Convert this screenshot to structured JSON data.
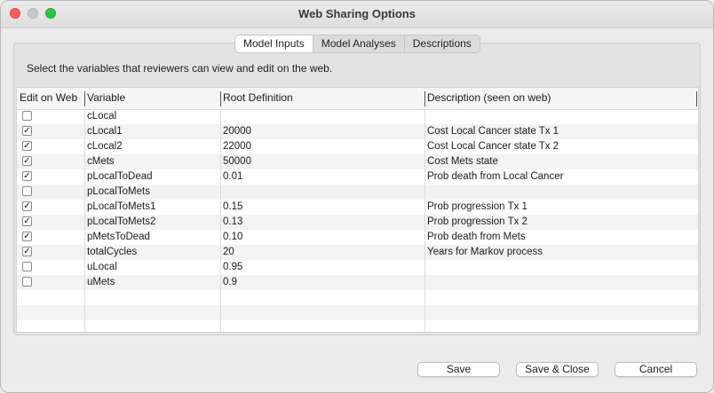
{
  "window": {
    "title": "Web Sharing Options"
  },
  "tabs": [
    {
      "label": "Model Inputs",
      "active": true
    },
    {
      "label": "Model Analyses",
      "active": false
    },
    {
      "label": "Descriptions",
      "active": false
    }
  ],
  "instruction": "Select the variables that reviewers can view and edit on the web.",
  "table": {
    "headers": [
      "Edit on Web",
      "Variable",
      "Root Definition",
      "Description (seen on web)"
    ],
    "rows": [
      {
        "edit": false,
        "variable": "cLocal",
        "root": "",
        "description": ""
      },
      {
        "edit": true,
        "variable": "cLocal1",
        "root": "20000",
        "description": "Cost Local Cancer state Tx 1"
      },
      {
        "edit": true,
        "variable": "cLocal2",
        "root": "22000",
        "description": "Cost Local Cancer state Tx 2"
      },
      {
        "edit": true,
        "variable": "cMets",
        "root": "50000",
        "description": "Cost Mets state"
      },
      {
        "edit": true,
        "variable": "pLocalToDead",
        "root": "0.01",
        "description": "Prob death from Local Cancer"
      },
      {
        "edit": false,
        "variable": "pLocalToMets",
        "root": "",
        "description": ""
      },
      {
        "edit": true,
        "variable": "pLocalToMets1",
        "root": "0.15",
        "description": "Prob progression Tx 1"
      },
      {
        "edit": true,
        "variable": "pLocalToMets2",
        "root": "0.13",
        "description": "Prob progression Tx 2"
      },
      {
        "edit": true,
        "variable": "pMetsToDead",
        "root": "0.10",
        "description": "Prob death from Mets"
      },
      {
        "edit": true,
        "variable": "totalCycles",
        "root": "20",
        "description": "Years for Markov process"
      },
      {
        "edit": false,
        "variable": "uLocal",
        "root": "0.95",
        "description": ""
      },
      {
        "edit": false,
        "variable": "uMets",
        "root": "0.9",
        "description": ""
      }
    ],
    "empty_rows": 3
  },
  "buttons": {
    "save": "Save",
    "save_close": "Save & Close",
    "cancel": "Cancel"
  },
  "colors": {
    "close": "#ff5f57",
    "minimize": "#c8c8c8",
    "maximize": "#28c840",
    "check": "✓"
  }
}
